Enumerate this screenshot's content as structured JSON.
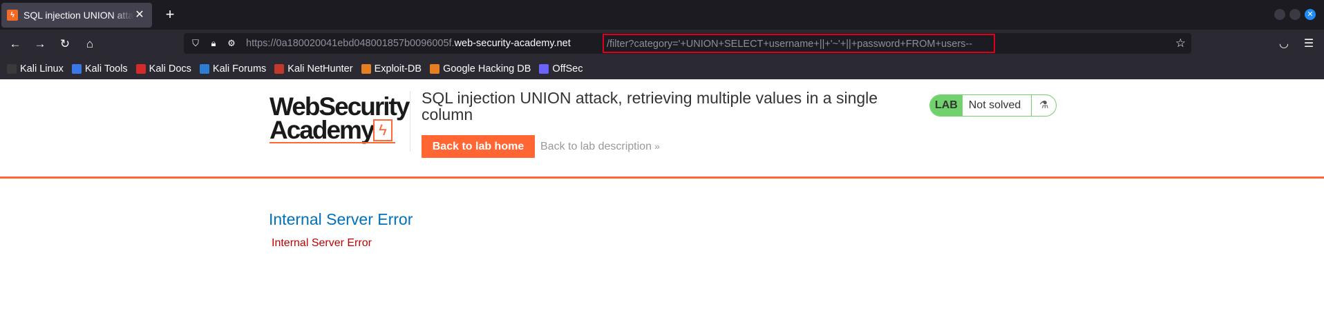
{
  "browser": {
    "tab_title": "SQL injection UNION attack, retrieving multiple values in a single column",
    "new_tab": "+",
    "url_scheme": "https://0a180020041ebd048001857b0096005f.",
    "url_domain": "web-security-academy.net",
    "url_path": "/filter?category='+UNION+SELECT+username+||+'~'+||+password+FROM+users--",
    "highlight_color": "#e0001b"
  },
  "bookmarks": [
    {
      "label": "Kali Linux",
      "icon": "kali-linux-icon",
      "color": "#3a3a3a"
    },
    {
      "label": "Kali Tools",
      "icon": "kali-tools-icon",
      "color": "#3b78e7"
    },
    {
      "label": "Kali Docs",
      "icon": "kali-docs-icon",
      "color": "#d52a2a"
    },
    {
      "label": "Kali Forums",
      "icon": "kali-forums-icon",
      "color": "#2d7dd2"
    },
    {
      "label": "Kali NetHunter",
      "icon": "kali-nethunter-icon",
      "color": "#c0392b"
    },
    {
      "label": "Exploit-DB",
      "icon": "exploit-db-icon",
      "color": "#e67e22"
    },
    {
      "label": "Google Hacking DB",
      "icon": "google-hacking-db-icon",
      "color": "#e67e22"
    },
    {
      "label": "OffSec",
      "icon": "offsec-icon",
      "color": "#6c63ff"
    }
  ],
  "page": {
    "logo_line1": "WebSecurity",
    "logo_line2": "Academy",
    "lab_title": "SQL injection UNION attack, retrieving multiple values in a single column",
    "back_home": "Back to lab home",
    "back_description": "Back to lab description",
    "lab_badge": "LAB",
    "lab_status": "Not solved",
    "accent": "#ff6633",
    "error_title": "Internal Server Error",
    "error_body": "Internal Server Error"
  }
}
